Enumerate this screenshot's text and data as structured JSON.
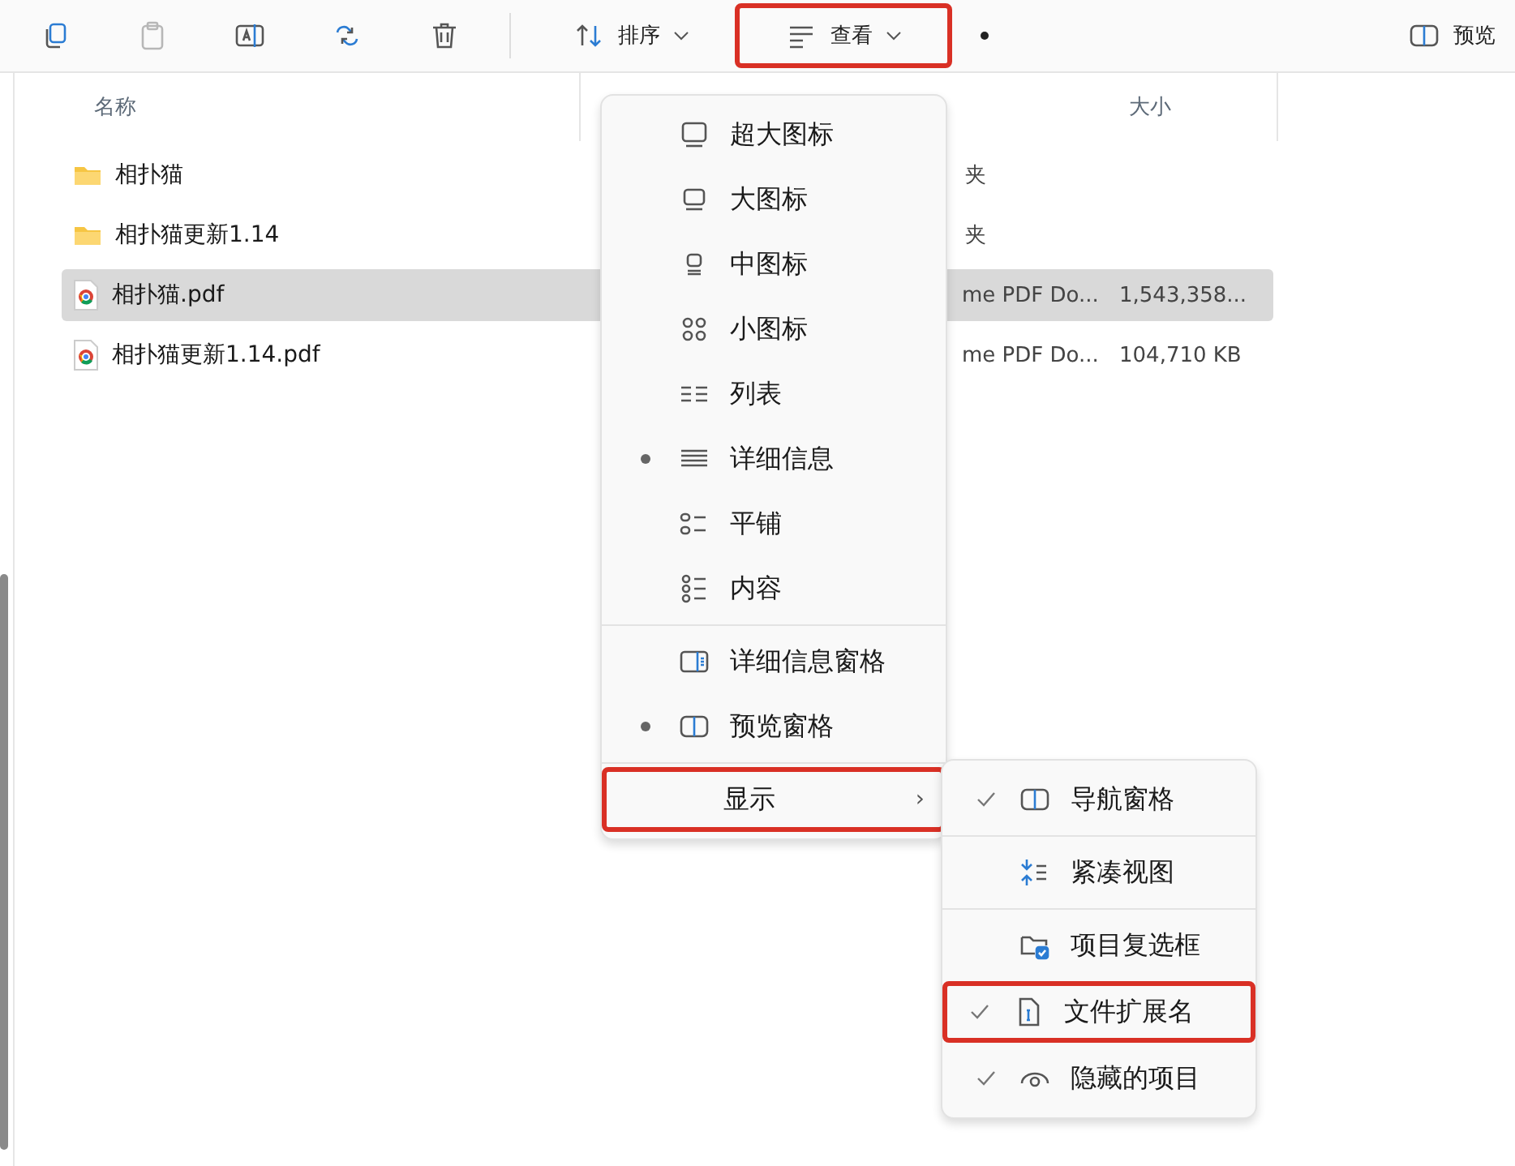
{
  "toolbar": {
    "buttons": [
      {
        "disabled": false
      },
      {
        "disabled": true
      },
      {
        "disabled": false
      },
      {
        "disabled": false
      },
      {
        "disabled": false
      },
      {
        "label": "排序",
        "disabled": false,
        "highlighted": false
      },
      {
        "label": "查看",
        "disabled": false,
        "highlighted": true
      },
      {
        "disabled": false
      }
    ],
    "preview": {
      "label": "预览"
    }
  },
  "columns": [
    {
      "label": "名称"
    },
    {
      "label": "大小"
    }
  ],
  "rows": [
    {
      "kind": "folder",
      "name": "相扑猫",
      "type": "夹",
      "selected": false
    },
    {
      "kind": "folder",
      "name": "相扑猫更新1.14",
      "type": "夹",
      "selected": false
    },
    {
      "kind": "pdf",
      "name": "相扑猫.pdf",
      "type": "me PDF Do...",
      "size": "1,543,358...",
      "selected": true
    },
    {
      "kind": "pdf",
      "name": "相扑猫更新1.14.pdf",
      "type": "me PDF Do...",
      "size": "104,710 KB",
      "selected": false
    }
  ],
  "view_menu": {
    "items": [
      {
        "kind": "item",
        "label": "超大图标",
        "selected": false
      },
      {
        "kind": "item",
        "label": "大图标",
        "selected": false
      },
      {
        "kind": "item",
        "label": "中图标",
        "selected": false
      },
      {
        "kind": "item",
        "label": "小图标",
        "selected": false
      },
      {
        "kind": "item",
        "label": "列表",
        "selected": false
      },
      {
        "kind": "item",
        "label": "详细信息",
        "selected": true
      },
      {
        "kind": "item",
        "label": "平铺",
        "selected": false
      },
      {
        "kind": "item",
        "label": "内容",
        "selected": false
      },
      {
        "kind": "divider"
      },
      {
        "kind": "item",
        "label": "详细信息窗格",
        "selected": false
      },
      {
        "kind": "item",
        "label": "预览窗格",
        "selected": true
      },
      {
        "kind": "divider"
      },
      {
        "kind": "submenu",
        "label": "显示",
        "arrow": "›",
        "highlighted": true
      }
    ]
  },
  "show_menu": {
    "items": [
      {
        "kind": "item",
        "label": "导航窗格",
        "checked": true,
        "highlighted": false
      },
      {
        "kind": "divider"
      },
      {
        "kind": "item",
        "label": "紧凑视图",
        "checked": false,
        "highlighted": false
      },
      {
        "kind": "divider"
      },
      {
        "kind": "item",
        "label": "项目复选框",
        "checked": false,
        "highlighted": false
      },
      {
        "kind": "item",
        "label": "文件扩展名",
        "checked": true,
        "highlighted": true
      },
      {
        "kind": "item",
        "label": "隐藏的项目",
        "checked": true,
        "highlighted": false
      }
    ]
  }
}
